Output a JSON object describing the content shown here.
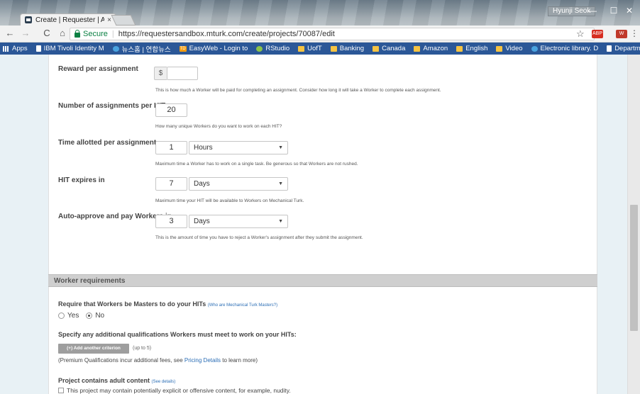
{
  "browser": {
    "tab_title": "Create | Requester | Am",
    "tab_close": "×",
    "profile_name": "Hyunji Seok",
    "window_controls": {
      "minimize": "—",
      "maximize": "☐",
      "close": "✕"
    },
    "nav": {
      "back": "←",
      "forward": "→",
      "reload": "C",
      "home": "⌂"
    },
    "secure_label": "Secure",
    "url_separator": "|",
    "url": "https://requestersandbox.mturk.com/create/projects/70087/edit",
    "extensions": {
      "abp": "ABP",
      "red": "W",
      "menu": "⋮",
      "star": "☆"
    },
    "bookmarks": [
      {
        "label": "Apps",
        "icon": "apps-icon"
      },
      {
        "label": "IBM Tivoli Identity M",
        "icon": "page-icon"
      },
      {
        "label": "뉴스홈 | 연합뉴스",
        "icon": "blue-globe-icon"
      },
      {
        "label": "EasyWeb - Login to",
        "icon": "td-icon"
      },
      {
        "label": "RStudio",
        "icon": "green-circle-icon"
      },
      {
        "label": "UofT",
        "icon": "folder-icon"
      },
      {
        "label": "Banking",
        "icon": "folder-icon"
      },
      {
        "label": "Canada",
        "icon": "folder-icon"
      },
      {
        "label": "Amazon",
        "icon": "folder-icon"
      },
      {
        "label": "English",
        "icon": "folder-icon"
      },
      {
        "label": "Video",
        "icon": "folder-icon"
      },
      {
        "label": "Electronic library. D",
        "icon": "blue-globe-icon"
      },
      {
        "label": "Department of Ling",
        "icon": "page-icon"
      }
    ],
    "bookmarks_more": "»",
    "td_badge": "TD"
  },
  "form": {
    "reward": {
      "label": "Reward per assignment",
      "currency": "$",
      "value": "",
      "helper": "This is how much a Worker will be paid for completing an assignment. Consider how long it will take a Worker to complete each assignment."
    },
    "assignments": {
      "label": "Number of assignments per HIT",
      "value": "20",
      "helper": "How many unique Workers do you want to work on each HIT?"
    },
    "time_allotted": {
      "label": "Time allotted per assignment",
      "value": "1",
      "unit": "Hours",
      "helper": "Maximum time a Worker has to work on a single task. Be generous so that Workers are not rushed."
    },
    "expires": {
      "label": "HIT expires in",
      "value": "7",
      "unit": "Days",
      "helper": "Maximum time your HIT will be available to Workers on Mechanical Turk."
    },
    "auto_approve": {
      "label": "Auto-approve and pay Workers in",
      "value": "3",
      "unit": "Days",
      "helper": "This is the amount of time you have to reject a Worker's assignment after they submit the assignment."
    },
    "caret": "▼"
  },
  "worker_requirements": {
    "section_title": "Worker requirements",
    "masters_label": "Require that Workers be Masters to do your HITs",
    "masters_link": "(Who are Mechanical Turk Masters?)",
    "options": [
      "Yes",
      "No"
    ],
    "selected": "No",
    "qualifications_label": "Specify any additional qualifications Workers must meet to work on your HITs:",
    "add_criterion_button": "(+) Add another criterion",
    "up_to": "(up to 5)",
    "premium_prefix": "(Premium Qualifications incur additional fees, see ",
    "premium_link": "Pricing Details",
    "premium_suffix": " to learn more)",
    "adult_label": "Project contains adult content",
    "adult_link": "(See details)",
    "adult_checkbox_label": "This project may contain potentially explicit or offensive content, for example, nudity."
  }
}
